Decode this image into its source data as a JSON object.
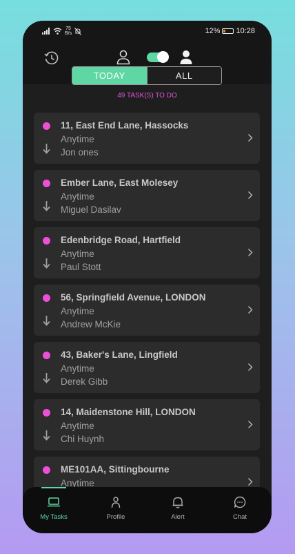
{
  "status": {
    "speed_value": "75",
    "speed_unit": "B/s",
    "battery": "12%",
    "time": "10:28"
  },
  "segments": {
    "today": "TODAY",
    "all": "ALL"
  },
  "task_count": "49 TASK(S) TO DO",
  "tasks": [
    {
      "address": "11, East End Lane, Hassocks",
      "time": "Anytime",
      "person": "Jon ones"
    },
    {
      "address": "Ember Lane, East Molesey",
      "time": "Anytime",
      "person": "Miguel Dasilav"
    },
    {
      "address": "Edenbridge Road, Hartfield",
      "time": "Anytime",
      "person": "Paul Stott"
    },
    {
      "address": "56, Springfield Avenue, LONDON",
      "time": "Anytime",
      "person": "Andrew McKie"
    },
    {
      "address": "43, Baker's Lane, Lingfield",
      "time": "Anytime",
      "person": "Derek Gibb"
    },
    {
      "address": "14, Maidenstone Hill, LONDON",
      "time": "Anytime",
      "person": "Chi Huynh"
    },
    {
      "address": "ME101AA, Sittingbourne",
      "time": "Anytime",
      "person": ""
    }
  ],
  "nav": {
    "my_tasks": "My Tasks",
    "profile": "Profile",
    "alert": "Alert",
    "chat": "Chat"
  },
  "colors": {
    "accent": "#5fd7a4",
    "task_dot": "#ef4fd6",
    "count_text": "#e253d8",
    "card": "#2c2c2c",
    "background": "#1e1e1e"
  },
  "icons": {
    "topbar": [
      "history-icon",
      "person-outline-icon",
      "toggle-switch",
      "person-filled-icon"
    ],
    "nav": [
      "laptop-icon",
      "person-icon",
      "bell-icon",
      "chat-bubble-icon"
    ]
  }
}
